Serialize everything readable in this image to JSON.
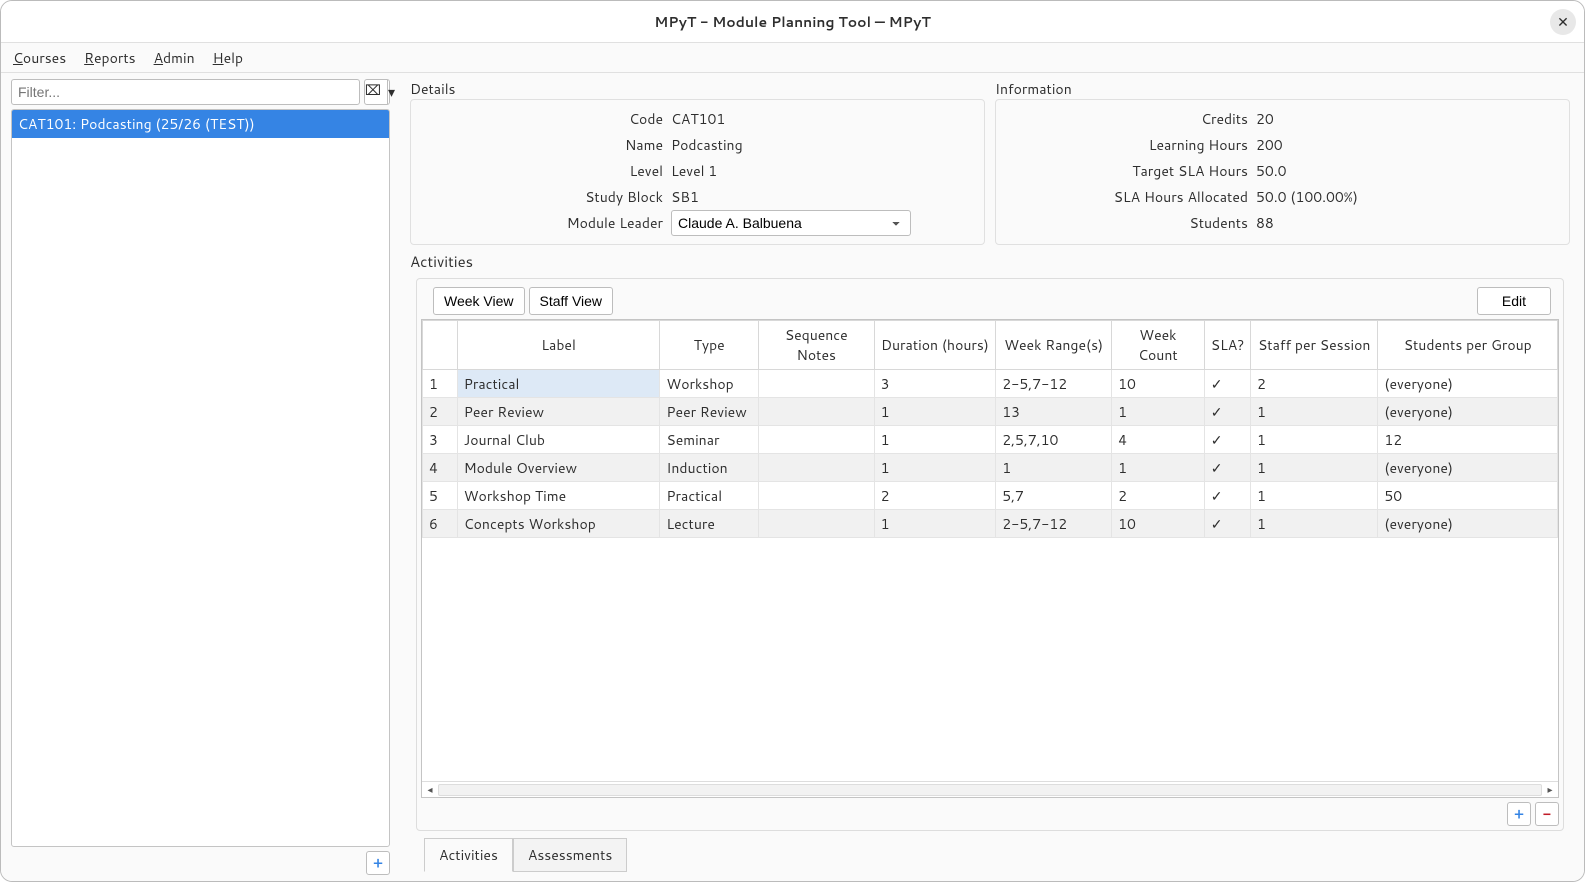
{
  "window": {
    "title": "MPyT - Module Planning Tool — MPyT"
  },
  "menu": {
    "courses": "Courses",
    "reports": "Reports",
    "admin": "Admin",
    "help": "Help"
  },
  "sidebar": {
    "filter_placeholder": "Filter...",
    "items": [
      {
        "label": "CAT101: Podcasting (25/26 (TEST))"
      }
    ]
  },
  "details": {
    "heading": "Details",
    "code_label": "Code",
    "code": "CAT101",
    "name_label": "Name",
    "name": "Podcasting",
    "level_label": "Level",
    "level": "Level 1",
    "study_block_label": "Study Block",
    "study_block": "SB1",
    "module_leader_label": "Module Leader",
    "module_leader": "Claude A. Balbuena"
  },
  "information": {
    "heading": "Information",
    "credits_label": "Credits",
    "credits": "20",
    "learning_hours_label": "Learning Hours",
    "learning_hours": "200",
    "target_sla_label": "Target SLA Hours",
    "target_sla": "50.0",
    "sla_allocated_label": "SLA Hours Allocated",
    "sla_allocated": "50.0 (100.00%)",
    "students_label": "Students",
    "students": "88"
  },
  "activities": {
    "heading": "Activities",
    "toolbar": {
      "week_view": "Week View",
      "staff_view": "Staff View",
      "edit": "Edit"
    },
    "columns": [
      "",
      "Label",
      "Type",
      "Sequence Notes",
      "Duration (hours)",
      "Week Range(s)",
      "Week Count",
      "SLA?",
      "Staff per Session",
      "Students per Group"
    ],
    "rows": [
      {
        "n": "1",
        "label": "Practical",
        "type": "Workshop",
        "seq": "",
        "dur": "3",
        "wr": "2-5,7-12",
        "wc": "10",
        "sla": "✓",
        "staff": "2",
        "spg": "(everyone)"
      },
      {
        "n": "2",
        "label": "Peer Review",
        "type": "Peer Review",
        "seq": "",
        "dur": "1",
        "wr": "13",
        "wc": "1",
        "sla": "✓",
        "staff": "1",
        "spg": "(everyone)"
      },
      {
        "n": "3",
        "label": "Journal Club",
        "type": "Seminar",
        "seq": "",
        "dur": "1",
        "wr": "2,5,7,10",
        "wc": "4",
        "sla": "✓",
        "staff": "1",
        "spg": "12"
      },
      {
        "n": "4",
        "label": "Module Overview",
        "type": "Induction",
        "seq": "",
        "dur": "1",
        "wr": "1",
        "wc": "1",
        "sla": "✓",
        "staff": "1",
        "spg": "(everyone)"
      },
      {
        "n": "5",
        "label": "Workshop Time",
        "type": "Practical",
        "seq": "",
        "dur": "2",
        "wr": "5,7",
        "wc": "2",
        "sla": "✓",
        "staff": "1",
        "spg": "50"
      },
      {
        "n": "6",
        "label": "Concepts Workshop",
        "type": "Lecture",
        "seq": "",
        "dur": "1",
        "wr": "2-5,7-12",
        "wc": "10",
        "sla": "✓",
        "staff": "1",
        "spg": "(everyone)"
      }
    ]
  },
  "tabs": {
    "activities": "Activities",
    "assessments": "Assessments"
  }
}
